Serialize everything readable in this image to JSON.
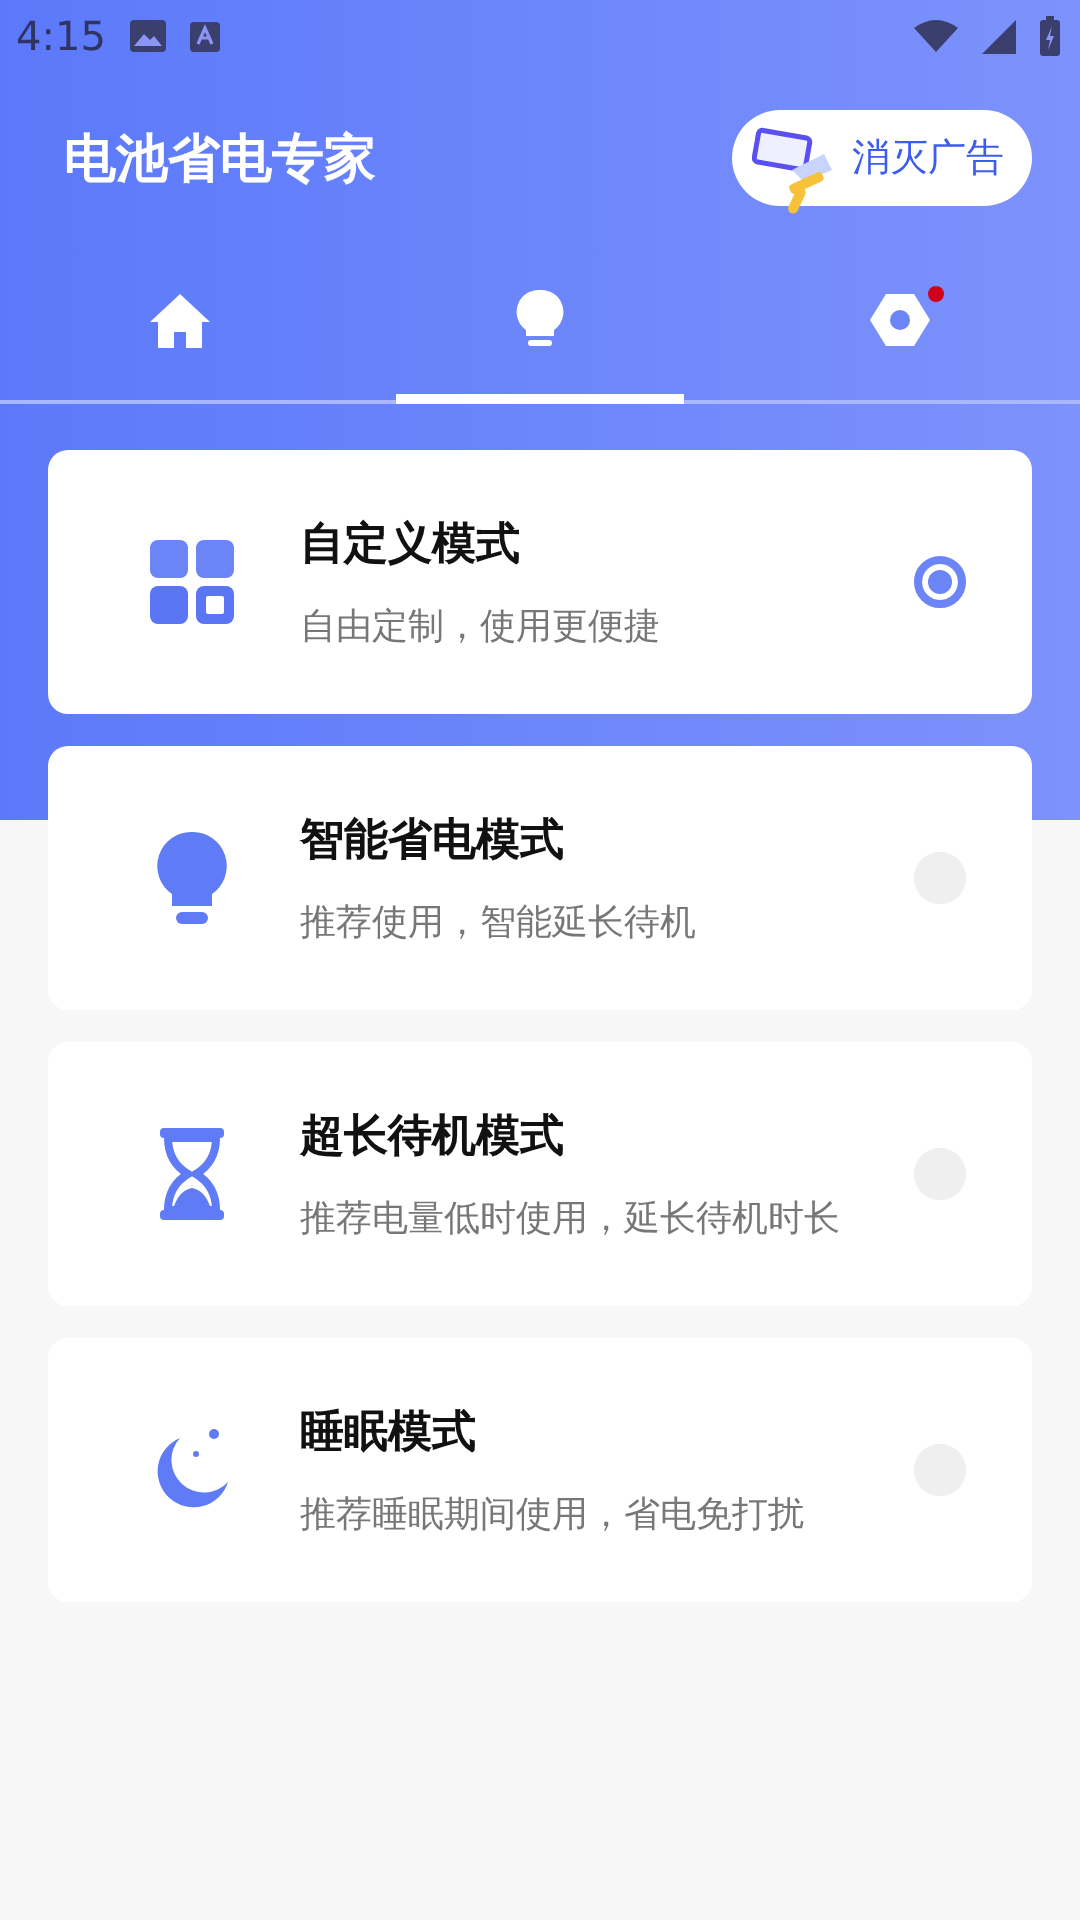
{
  "status_bar": {
    "time": "4:15"
  },
  "header": {
    "title": "电池省电专家",
    "ad_button": "消灭广告"
  },
  "tabs": [
    {
      "kind": "home",
      "selected": false,
      "badge": false
    },
    {
      "kind": "bulb",
      "selected": true,
      "badge": false
    },
    {
      "kind": "settings",
      "selected": false,
      "badge": true
    }
  ],
  "modes": [
    {
      "kind": "grid",
      "title": "自定义模式",
      "subtitle": "自由定制，使用更便捷",
      "selected": true
    },
    {
      "kind": "bulb",
      "title": "智能省电模式",
      "subtitle": "推荐使用，智能延长待机",
      "selected": false
    },
    {
      "kind": "hourglass",
      "title": "超长待机模式",
      "subtitle": "推荐电量低时使用，延长待机时长",
      "selected": false
    },
    {
      "kind": "moon",
      "title": "睡眠模式",
      "subtitle": "推荐睡眠期间使用，省电免打扰",
      "selected": false
    }
  ]
}
